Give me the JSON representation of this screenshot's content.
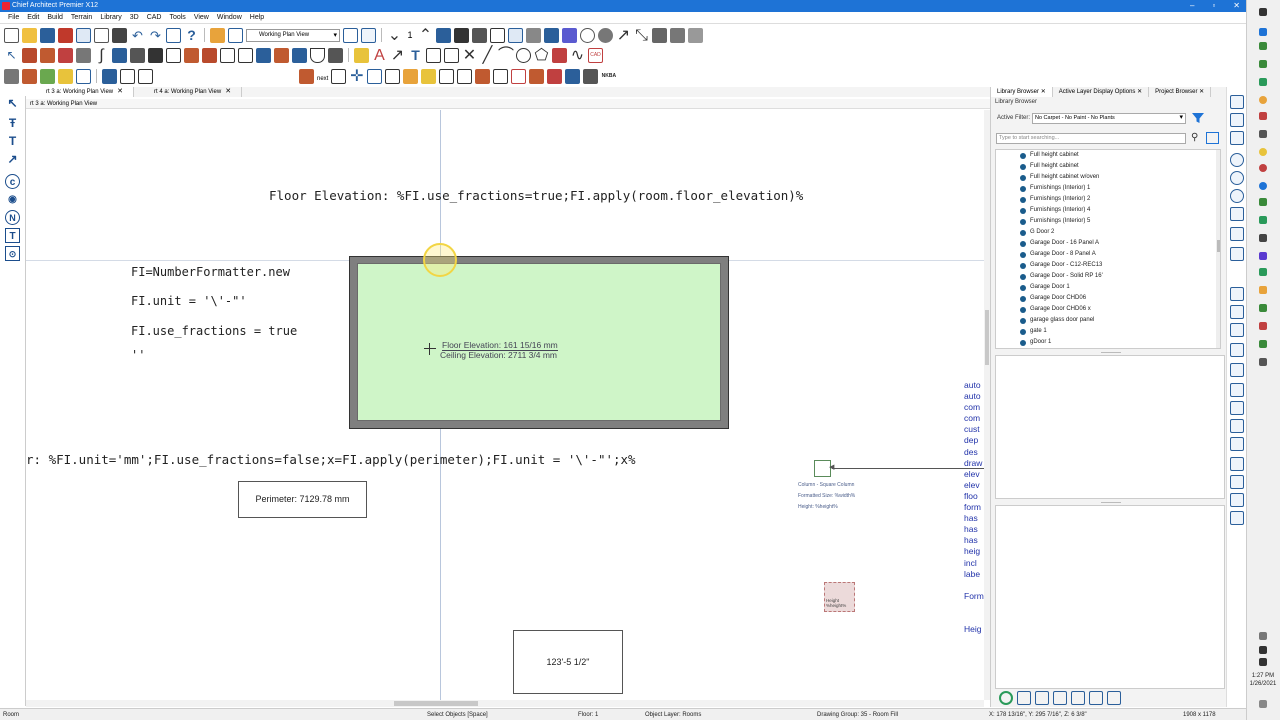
{
  "window": {
    "title": "Chief Architect Premier X12",
    "min": "–",
    "max": "▫",
    "close": "✕"
  },
  "menu": [
    "File",
    "Edit",
    "Build",
    "Terrain",
    "Library",
    "3D",
    "CAD",
    "Tools",
    "View",
    "Window",
    "Help"
  ],
  "toolbar": {
    "view_select": "Working Plan View",
    "counter": "1",
    "next_label": "next",
    "nkba_label": "NKBA",
    "cad_label": "CAD"
  },
  "doc_tabs": [
    {
      "label": "rt 3 a:  Working Plan View",
      "close": "✕"
    },
    {
      "label": "rt 4 a:  Working Plan View",
      "close": "✕"
    }
  ],
  "sub_tab": "rt 3 a:  Working Plan View",
  "canvas": {
    "floor_elevation_macro": "Floor Elevation: %FI.use_fractions=true;FI.apply(room.floor_elevation)%",
    "code_lines": [
      "FI=NumberFormatter.new",
      "FI.unit = '\\'-\"'",
      "FI.use_fractions = true",
      "''"
    ],
    "room_label_floor": "Floor Elevation: 161 15/16 mm",
    "room_label_ceiling": "Ceiling Elevation: 2711 3/4 mm",
    "perimeter_macro": "r: %FI.unit='mm';FI.use_fractions=false;x=FI.apply(perimeter);FI.unit = '\\'-\"';x%",
    "perimeter_box": "Perimeter: 7129.78 mm",
    "dimension_box": "123'-5 1/2\"",
    "column_text": [
      "Column - Square Column",
      "Formatted Size: %width%",
      "Height: %height%"
    ],
    "pink_box_text": [
      "Height",
      "%height%"
    ],
    "side_list": [
      "auto",
      "auto",
      "com",
      "com",
      "cust",
      "dep",
      "des",
      "draw",
      "elev",
      "elev",
      "floo",
      "form",
      "has",
      "has",
      "has",
      "heig",
      "incl",
      "labe",
      "",
      "Form",
      "",
      "",
      "Heig"
    ]
  },
  "library": {
    "tabs": [
      {
        "label": "Library Browser",
        "close": "✕"
      },
      {
        "label": "Active Layer Display Options",
        "close": "✕"
      },
      {
        "label": "Project Browser",
        "close": "✕"
      }
    ],
    "title": "Library Browser",
    "filter_label": "Active Filter:",
    "filter_value": "No Carpet - No Paint - No Plants",
    "search_placeholder": "Type to start searching...",
    "items": [
      "Full height cabinet",
      "Full height cabinet",
      "Full height cabinet w/oven",
      "Furnishings (Interior) 1",
      "Furnishings (Interior) 2",
      "Furnishings (Interior) 4",
      "Furnishings (Interior) 5",
      "G Door 2",
      "Garage Door - 16 Panel A",
      "Garage Door - 8 Panel A",
      "Garage Door - C12-REC13",
      "Garage Door - Solid RP 16'",
      "Garage Door 1",
      "Garage Door CHD06",
      "Garage Door CHD06 x",
      "garage glass door panel",
      "gate 1",
      "gDoor 1"
    ]
  },
  "statusbar": {
    "room": "Room",
    "mode": "Select Objects [Space]",
    "floor": "Floor: 1",
    "layer": "Object Layer: Rooms",
    "group": "Drawing Group: 35 - Room Fill",
    "coords": "X: 178 13/16\", Y: 295 7/16\", Z: 6 3/8\"",
    "size": "1908 x 1178"
  },
  "clock": {
    "time": "1:27 PM",
    "date": "1/26/2021"
  },
  "colors": {
    "title_bar": "#1e73d6",
    "room_fill": "#cff5c8",
    "wall": "#7f7f7f",
    "link_text": "#2233aa"
  }
}
